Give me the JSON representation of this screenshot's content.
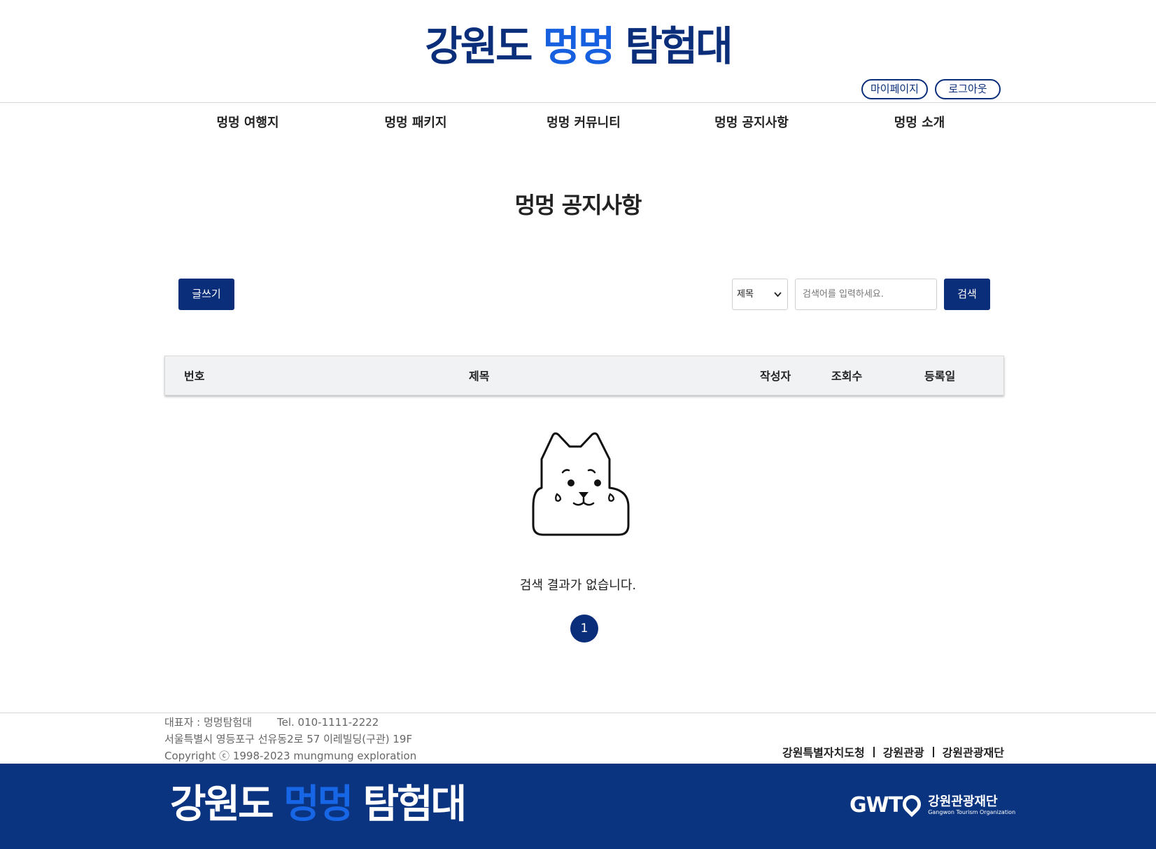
{
  "logo": {
    "part1": "강원도 ",
    "part2": "멍멍",
    "part3": " 탐험대"
  },
  "user_buttons": {
    "mypage": "마이페이지",
    "logout": "로그아웃"
  },
  "nav": [
    "멍멍 여행지",
    "멍멍 패키지",
    "멍멍 커뮤니티",
    "멍멍 공지사항",
    "멍멍 소개"
  ],
  "page_title": "멍멍 공지사항",
  "toolbar": {
    "write_label": "글쓰기",
    "select_value": "제목",
    "search_placeholder": "검색어를 입력하세요.",
    "search_label": "검색"
  },
  "table": {
    "columns": [
      "번호",
      "제목",
      "작성자",
      "조회수",
      "등록일"
    ]
  },
  "empty_message": "검색 결과가 없습니다.",
  "pagination": {
    "current": "1"
  },
  "footer": {
    "representative": "대표자 : 멍멍탐험대",
    "tel": "Tel. 010-1111-2222",
    "address": "서울특별시 영등포구 선유동2로 57 이레빌딩(구관) 19F",
    "copyright": "Copyright ⓒ 1998-2023 mungmung exploration",
    "links": [
      "강원특별자치도청",
      "강원관광",
      "강원관광재단"
    ],
    "gwto_mark": "GWT",
    "gwto_ko": "강원관광재단",
    "gwto_en": "Gangwon Tourism Organization"
  },
  "colors": {
    "navy": "#0a2e7a",
    "accent_blue": "#1660e0",
    "footer_bar": "#0a3380"
  },
  "icons": {
    "empty_state": "crying-dog-icon",
    "select_chevron": "chevron-down-icon"
  }
}
